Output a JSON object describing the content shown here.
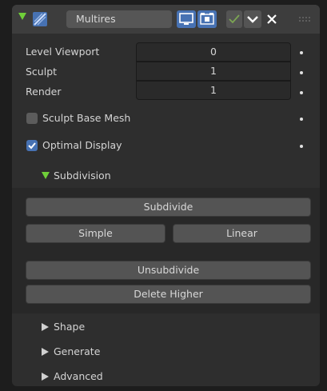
{
  "modifier": {
    "name": "Multires"
  },
  "properties": [
    {
      "label": "Level Viewport",
      "value": "0"
    },
    {
      "label": "Sculpt",
      "value": "1"
    },
    {
      "label": "Render",
      "value": "1"
    }
  ],
  "options": [
    {
      "label": "Sculpt Base Mesh",
      "checked": false
    },
    {
      "label": "Optimal Display",
      "checked": true
    }
  ],
  "subdivision": {
    "title": "Subdivision",
    "expanded": true,
    "subdivide_label": "Subdivide",
    "simple_label": "Simple",
    "linear_label": "Linear",
    "unsubdivide_label": "Unsubdivide",
    "delete_higher_label": "Delete Higher"
  },
  "collapsed_panels": [
    {
      "title": "Shape"
    },
    {
      "title": "Generate"
    },
    {
      "title": "Advanced"
    }
  ],
  "colors": {
    "accent_blue": "#4772b3",
    "expand_green": "#6fcf39",
    "panel_bg": "#2e2e2e",
    "header_bg": "#3d3d3d"
  }
}
